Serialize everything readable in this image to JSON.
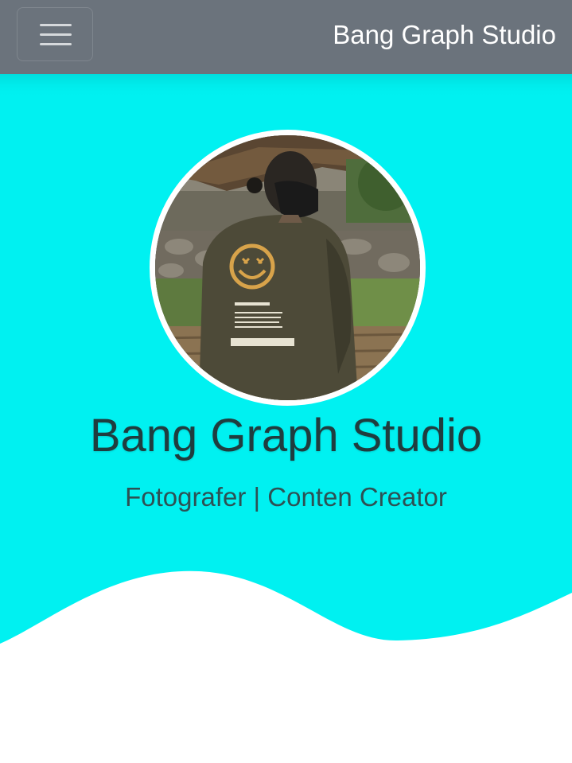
{
  "navbar": {
    "brand": "Bang Graph Studio",
    "menu_icon": "hamburger-menu-icon",
    "background_color": "#6b737c"
  },
  "hero": {
    "background_color": "#00f1f1",
    "avatar_alt": "profile photo of photographer in olive jacket and black mask",
    "name": "Bang Graph Studio",
    "subtitle": "Fotografer | Conten Creator"
  }
}
